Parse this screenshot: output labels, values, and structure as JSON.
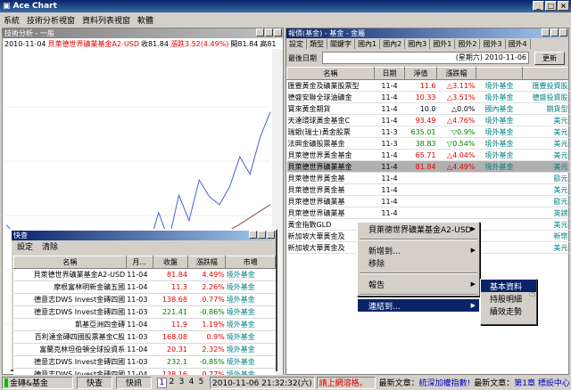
{
  "app": {
    "title": "Ace Chart"
  },
  "menubar": [
    "系統",
    "技術分析視窗",
    "資料列表視窗",
    "軟體"
  ],
  "chart_window": {
    "title": "技術分析 - 一般",
    "info": {
      "date": "2010-11-04",
      "name": "貝萊德世界礦業基金A2-USD",
      "close": "收81.84",
      "change": "漲跌3.52(4.49%)",
      "open": "開81.84",
      "high": "高81"
    }
  },
  "chart_data": {
    "type": "line",
    "series": [
      {
        "values": [
          66.2,
          64.8,
          60.1,
          57.3,
          59.5,
          58.0,
          61.2,
          55.4,
          63.0,
          59.8,
          57.4,
          62.6,
          61.5,
          65.1,
          63.2,
          67.9,
          64.1,
          70.3,
          66.8,
          72.4,
          70.1,
          69.0,
          71.5,
          75.6,
          73.2,
          78.3,
          81.8
        ]
      },
      {
        "values": [
          null,
          null,
          null,
          null,
          null,
          null,
          null,
          null,
          null,
          null,
          null,
          null,
          58.0,
          58.6,
          59.2,
          59.9,
          60.5,
          61.2,
          62.0,
          62.8,
          63.6,
          64.5,
          65.5,
          66.3,
          67.2,
          68.1,
          69.0
        ]
      },
      {
        "values": [
          null,
          null,
          null,
          null,
          null,
          null,
          null,
          null,
          null,
          null,
          null,
          null,
          null,
          null,
          null,
          null,
          null,
          null,
          53.5,
          54.6,
          55.8,
          57.0,
          58.3,
          59.6,
          60.9,
          62.2,
          63.6
        ]
      }
    ],
    "ylim": [
      45,
      90
    ]
  },
  "quote_window": {
    "title": "快查",
    "toolbar": [
      "設定",
      "清除"
    ],
    "columns": [
      "名稱",
      "月...",
      "收盤",
      "漲跌幅",
      "市場"
    ],
    "rows": [
      {
        "name": "貝萊德世界礦業基金A2-USD",
        "date": "11-04",
        "close": "81.84",
        "pct": "4.49%",
        "market": "境外基金",
        "dir": "up"
      },
      {
        "name": "摩根富林明新金礦五國",
        "date": "11-04",
        "close": "11.3",
        "pct": "2.26%",
        "market": "境外基金",
        "dir": "up"
      },
      {
        "name": "德意志DWS Invest金磚四國",
        "date": "11-03",
        "close": "138.68",
        "pct": "0.77%",
        "market": "境外基金",
        "dir": "up"
      },
      {
        "name": "德意志DWS Invest金磚四國",
        "date": "11-03",
        "close": "221.41",
        "pct": "-0.86%",
        "market": "境外基金",
        "dir": "down"
      },
      {
        "name": "凱基亞洲四金磚",
        "date": "11-04",
        "close": "11.9",
        "pct": "1.19%",
        "market": "境外基金",
        "dir": "up"
      },
      {
        "name": "百利達金磚四國股票基金C股",
        "date": "11-03",
        "close": "168.08",
        "pct": "0.9%",
        "market": "境外基金",
        "dir": "up"
      },
      {
        "name": "富蘭克林坦伯頓全球投資系",
        "date": "11-04",
        "close": "20.31",
        "pct": "2.32%",
        "market": "境外基金",
        "dir": "up"
      },
      {
        "name": "德意志DWS Invest金磚四國",
        "date": "11-03",
        "close": "232.1",
        "pct": "-0.85%",
        "market": "境外基金",
        "dir": "down"
      },
      {
        "name": "德意志DWS Invest金磚四國",
        "date": "11-04",
        "close": "138.16",
        "pct": "0.77%",
        "market": "境外基金",
        "dir": "up"
      }
    ]
  },
  "fund_window": {
    "title": "報價(基金) - 基金 - 金屬",
    "tabs": [
      "設定",
      "類型",
      "關鍵字",
      "國內1",
      "國內2",
      "國內3",
      "國外1",
      "國外2",
      "國外3",
      "國外4"
    ],
    "date_label": "最後日期",
    "date_value": "(星期六) 2010-11-06",
    "refresh_label": "更新",
    "columns": [
      "名稱",
      "日期",
      "淨值",
      "漲跌幅"
    ],
    "rows": [
      {
        "name": "匯豐黃金及礦業股票型",
        "date": "11-4",
        "nav": "11.6",
        "pct": "3.11%",
        "market": "境外基金",
        "mgr": "匯豐投資股",
        "dir": "up"
      },
      {
        "name": "德盛安聯全球油礦金",
        "date": "11-4",
        "nav": "10.33",
        "pct": "3.51%",
        "market": "境外基金",
        "mgr": "德盛投資股",
        "dir": "up"
      },
      {
        "name": "寶來黃金期貨",
        "date": "11-4",
        "nav": "10.0",
        "pct": "0.0%",
        "market": "國內基金",
        "mgr": "期貨型",
        "dir": "flat"
      },
      {
        "name": "天達環球黃金基金C",
        "date": "11-4",
        "nav": "93.49",
        "pct": "4.76%",
        "market": "境外基金",
        "mgr": "美元",
        "dir": "up"
      },
      {
        "name": "瑞銀(瑞士)黃金股票",
        "date": "11-3",
        "nav": "635.01",
        "pct": "0.9%",
        "market": "境外基金",
        "mgr": "美元",
        "dir": "down"
      },
      {
        "name": "法興金礦股票基金",
        "date": "11-3",
        "nav": "38.83",
        "pct": "0.54%",
        "market": "境外基金",
        "mgr": "美元",
        "dir": "down"
      },
      {
        "name": "貝萊德世界黃金基金",
        "date": "11-4",
        "nav": "65.71",
        "pct": "4.04%",
        "market": "境外基金",
        "mgr": "美元",
        "dir": "up"
      },
      {
        "name": "貝萊德世界礦業基金",
        "date": "11-4",
        "nav": "81.84",
        "pct": "4.49%",
        "market": "境外基金",
        "mgr": "美元",
        "dir": "up",
        "selected": true
      },
      {
        "name": "貝萊德世界黃金基",
        "date": "11-4",
        "nav": "",
        "pct": "",
        "market": "",
        "mgr": "歐元",
        "dir": "up"
      },
      {
        "name": "貝萊德世界黃金基",
        "date": "11-4",
        "nav": "",
        "pct": "",
        "market": "",
        "mgr": "美元",
        "dir": "up"
      },
      {
        "name": "貝萊德世界礦業基",
        "date": "11-4",
        "nav": "",
        "pct": "",
        "market": "",
        "mgr": "歐元",
        "dir": "up"
      },
      {
        "name": "貝萊德世界礦業基",
        "date": "11-4",
        "nav": "",
        "pct": "",
        "market": "",
        "mgr": "英鎊",
        "dir": "up"
      },
      {
        "name": "黃金指數GLD",
        "date": "11-4",
        "nav": "",
        "pct": "",
        "market": "",
        "mgr": "美元",
        "dir": "up"
      },
      {
        "name": "新加坡大華黃金及",
        "date": "11-4",
        "nav": "",
        "pct": "",
        "market": "",
        "mgr": "新幣",
        "dir": "up"
      },
      {
        "name": "新加坡大華黃金及",
        "date": "11-4",
        "nav": "",
        "pct": "",
        "market": "",
        "mgr": "美元",
        "dir": "up"
      }
    ]
  },
  "context_menu": {
    "items": [
      "貝萊德世界礦業基金A2-USD",
      "新增到...",
      "移除",
      "報告",
      "連結到..."
    ],
    "submenu": [
      "基本資料",
      "持股明細",
      "績效走勢"
    ]
  },
  "status": {
    "category": "金磚&基金",
    "quick_label": "快查",
    "quote_label": "快訊",
    "pages": [
      "1",
      "2",
      "3",
      "4",
      "5"
    ],
    "datetime": "2010-11-06 21:32:32(六)",
    "alert": "請上網溶格。",
    "news1_label": "最新文章：",
    "news1_text": "統深加權指數!",
    "news2_label": "最新文章：",
    "news2_text": "第1章 標設中心"
  },
  "colors": {
    "up": "#e00000",
    "down": "#008000",
    "link": "#0000cc"
  }
}
